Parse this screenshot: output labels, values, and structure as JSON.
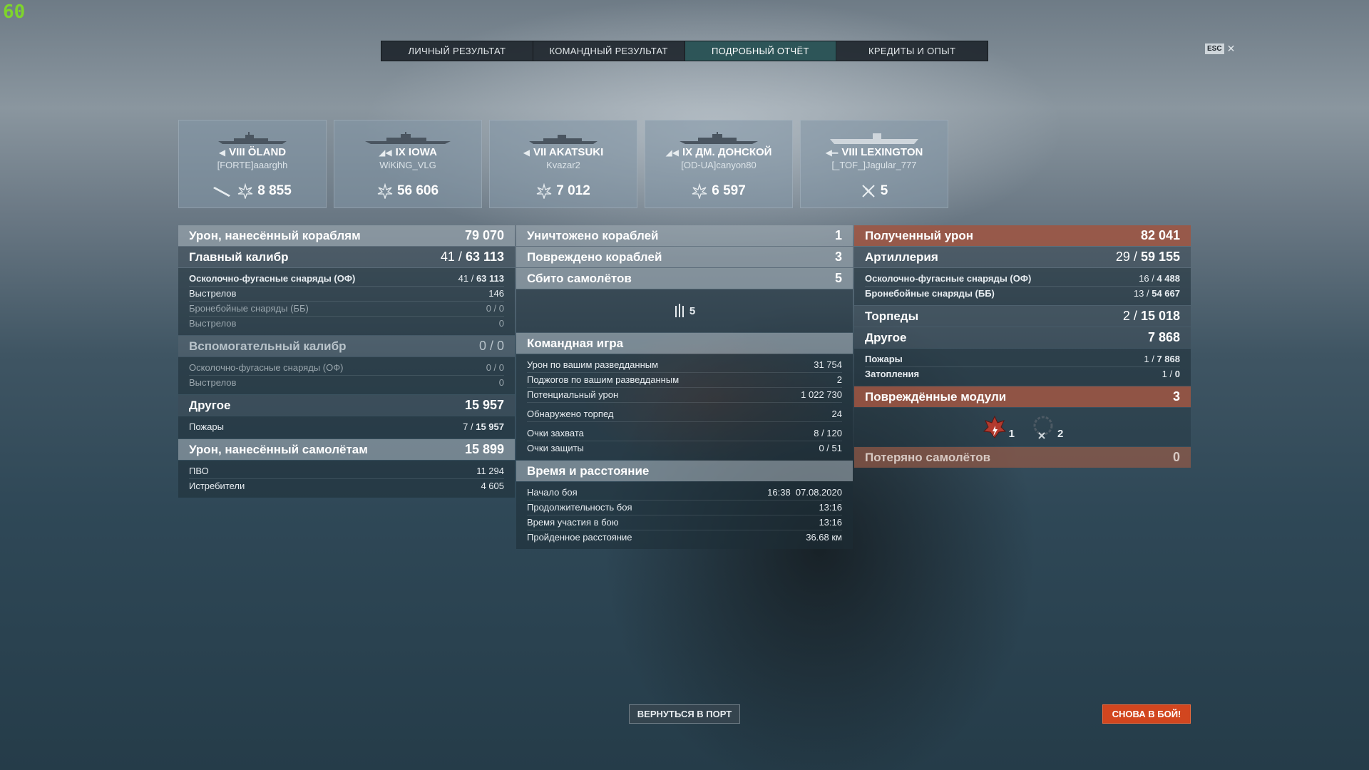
{
  "fps": "60",
  "tabs": [
    {
      "label": "ЛИЧНЫЙ РЕЗУЛЬТАТ"
    },
    {
      "label": "КОМАНДНЫЙ РЕЗУЛЬТАТ"
    },
    {
      "label": "ПОДРОБНЫЙ ОТЧЁТ"
    },
    {
      "label": "КРЕДИТЫ И ОПЫТ"
    }
  ],
  "esc": {
    "key": "ESC",
    "close": "✕"
  },
  "ships": [
    {
      "tier_name": "VIII ÖLAND",
      "player": "[FORTE]aaarghh",
      "value": "8 855"
    },
    {
      "tier_name": "IX IOWA",
      "player": "WiKiNG_VLG",
      "value": "56 606"
    },
    {
      "tier_name": "VII AKATSUKI",
      "player": "Kvazar2",
      "value": "7 012"
    },
    {
      "tier_name": "IX ДМ. ДОНСКОЙ",
      "player": "[OD-UA]canyon80",
      "value": "6 597"
    },
    {
      "tier_name": "VIII LEXINGTON",
      "player": "[_TOF_]Jagular_777",
      "value": "5"
    }
  ],
  "left": {
    "damage_ships": {
      "label": "Урон, нанесённый кораблям",
      "value": "79 070"
    },
    "main_battery": {
      "label": "Главный калибр",
      "hits": "41 /",
      "value": "63 113"
    },
    "main_rows": [
      {
        "label": "Осколочно-фугасные снаряды (ОФ)",
        "hits": "41 /",
        "value": "63 113"
      },
      {
        "label": "Выстрелов",
        "value": "146"
      },
      {
        "label": "Бронебойные снаряды (ББ)",
        "value": "0 / 0"
      },
      {
        "label": "Выстрелов",
        "value": "0"
      }
    ],
    "secondary": {
      "label": "Вспомогательный калибр",
      "value": "0 / 0"
    },
    "secondary_rows": [
      {
        "label": "Осколочно-фугасные снаряды (ОФ)",
        "value": "0 / 0"
      },
      {
        "label": "Выстрелов",
        "value": "0"
      }
    ],
    "other": {
      "label": "Другое",
      "value": "15 957"
    },
    "other_rows": [
      {
        "label": "Пожары",
        "hits": "7 /",
        "value": "15 957"
      }
    ],
    "damage_planes": {
      "label": "Урон, нанесённый самолётам",
      "value": "15 899"
    },
    "planes_rows": [
      {
        "label": "ПВО",
        "value": "11 294"
      },
      {
        "label": "Истребители",
        "value": "4 605"
      }
    ]
  },
  "mid": {
    "destroyed": {
      "label": "Уничтожено кораблей",
      "value": "1"
    },
    "damaged": {
      "label": "Повреждено кораблей",
      "value": "3"
    },
    "planes_shot": {
      "label": "Сбито самолётов",
      "value": "5"
    },
    "planes_icon_value": "5",
    "team": {
      "label": "Командная игра"
    },
    "team_rows_a": [
      {
        "label": "Урон по вашим разведданным",
        "value": "31 754"
      },
      {
        "label": "Поджогов по вашим разведданным",
        "value": "2"
      },
      {
        "label": "Потенциальный урон",
        "value": "1 022 730"
      }
    ],
    "team_rows_b": [
      {
        "label": "Обнаружено торпед",
        "value": "24"
      }
    ],
    "team_rows_c": [
      {
        "label": "Очки захвата",
        "value": "8 / 120"
      },
      {
        "label": "Очки защиты",
        "value": "0 / 51"
      }
    ],
    "time": {
      "label": "Время и расстояние"
    },
    "time_rows": [
      {
        "label": "Начало боя",
        "value": "16:38  07.08.2020"
      },
      {
        "label": "Продолжительность боя",
        "value": "13:16"
      },
      {
        "label": "Время участия в бою",
        "value": "13:16"
      },
      {
        "label": "Пройденное расстояние",
        "value": "36.68 км"
      }
    ]
  },
  "right": {
    "received": {
      "label": "Полученный урон",
      "value": "82 041"
    },
    "artillery": {
      "label": "Артиллерия",
      "hits": "29 /",
      "value": "59 155"
    },
    "art_rows": [
      {
        "label": "Осколочно-фугасные снаряды (ОФ)",
        "hits": "16 /",
        "value": "4 488"
      },
      {
        "label": "Бронебойные снаряды (ББ)",
        "hits": "13 /",
        "value": "54 667"
      }
    ],
    "torpedoes": {
      "label": "Торпеды",
      "hits": "2 /",
      "value": "15 018"
    },
    "other": {
      "label": "Другое",
      "value": "7 868"
    },
    "other_rows": [
      {
        "label": "Пожары",
        "hits": "1 /",
        "value": "7 868"
      },
      {
        "label": "Затопления",
        "hits": "1 /",
        "value": "0"
      }
    ],
    "modules": {
      "label": "Повреждённые модули",
      "value": "3"
    },
    "module_icons": [
      {
        "icon": "fire-incapacitated-icon",
        "count": "1"
      },
      {
        "icon": "module-destroyed-icon",
        "count": "2"
      }
    ],
    "planes_lost": {
      "label": "Потеряно самолётов",
      "value": "0"
    }
  },
  "buttons": {
    "port": "ВЕРНУТЬСЯ В ПОРТ",
    "battle": "СНОВА В БОЙ!"
  },
  "colors": {
    "accent_tab": "#2d5a5c",
    "battle_button": "#d2461f",
    "received_header": "#a05541",
    "fps": "#7ed42c"
  }
}
